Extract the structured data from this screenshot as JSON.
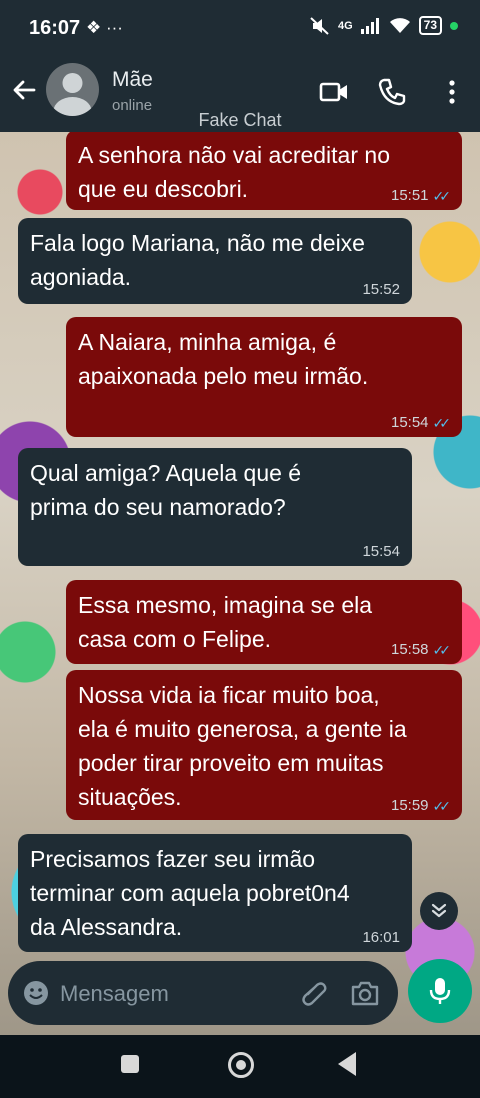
{
  "status_bar": {
    "time": "16:07",
    "left_icons": "❖ ···",
    "network": "4G",
    "battery": "73"
  },
  "header": {
    "contact_name": "Mãe",
    "contact_status": "online",
    "watermark": "Fake Chat"
  },
  "messages": [
    {
      "direction": "out",
      "text": "A senhora não vai acreditar no\nque eu descobri.",
      "time": "15:51",
      "read": true
    },
    {
      "direction": "in",
      "text": "Fala logo Mariana, não me deixe\nagoniada.",
      "time": "15:52"
    },
    {
      "direction": "out",
      "text": "A Naiara, minha amiga, é\napaixonada pelo meu irmão.",
      "time": "15:54",
      "read": true
    },
    {
      "direction": "in",
      "text": "Qual amiga? Aquela que é\nprima do seu namorado?",
      "time": "15:54"
    },
    {
      "direction": "out",
      "text": "Essa mesmo, imagina se ela\ncasa com o Felipe.",
      "time": "15:58",
      "read": true
    },
    {
      "direction": "out",
      "text": "Nossa vida ia ficar muito boa,\nela é muito generosa, a gente ia\npoder tirar proveito em muitas\nsituações.",
      "time": "15:59",
      "read": true
    },
    {
      "direction": "in",
      "text": "Precisamos fazer seu irmão\nterminar com aquela pobret0n4\nda Alessandra.",
      "time": "16:01"
    }
  ],
  "input": {
    "placeholder": "Mensagem"
  },
  "colors": {
    "outgoing_bubble": "#7a0a0a",
    "incoming_bubble": "#1f2c34",
    "accent": "#00a884",
    "read_ticks": "#53bdeb"
  },
  "icons": [
    "back-arrow-icon",
    "video-call-icon",
    "phone-icon",
    "more-vert-icon",
    "emoji-icon",
    "attach-icon",
    "camera-icon",
    "mic-icon",
    "chevron-down-icon"
  ]
}
